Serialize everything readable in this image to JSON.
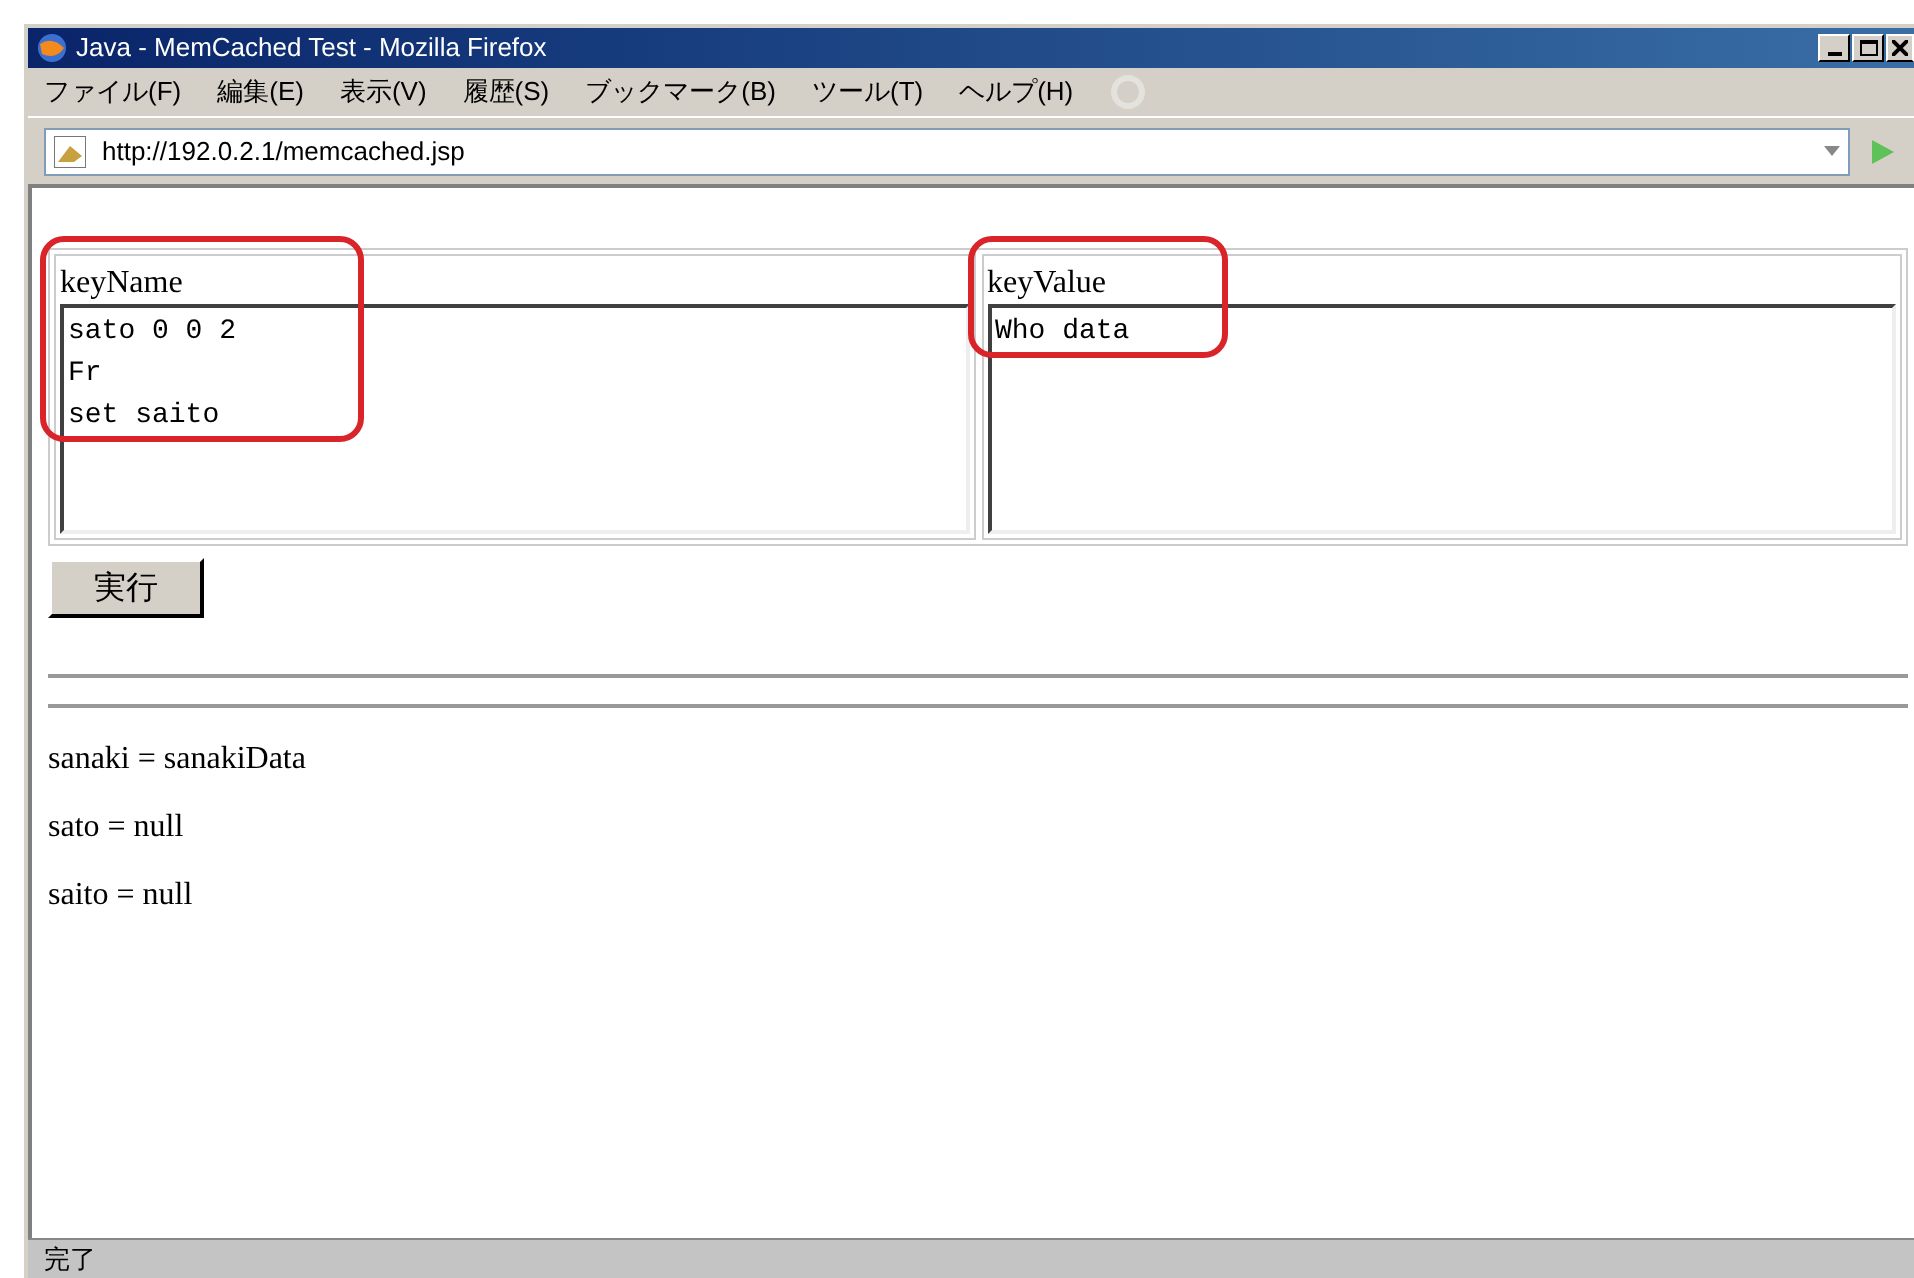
{
  "window": {
    "title": "Java - MemCached Test - Mozilla Firefox"
  },
  "menu": [
    "ファイル(F)",
    "編集(E)",
    "表示(V)",
    "履歴(S)",
    "ブックマーク(B)",
    "ツール(T)",
    "ヘルプ(H)"
  ],
  "address": {
    "value": "http://192.0.2.1/memcached.jsp"
  },
  "fields": [
    {
      "label": "keyName",
      "lines": [
        "sato 0 0 2",
        "Fr",
        "set saito"
      ]
    },
    {
      "label": "keyValue",
      "lines": [
        "Who data"
      ]
    }
  ],
  "submit": "実行",
  "results": [
    "sanaki = sanakiData",
    "sato = null",
    "saito = null"
  ],
  "status_bar": "完了"
}
